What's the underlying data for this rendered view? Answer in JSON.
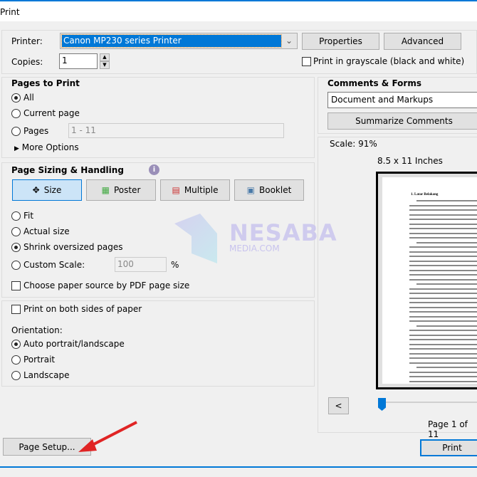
{
  "window": {
    "title": "Print"
  },
  "printer": {
    "label": "Printer:",
    "value": "Canon MP230 series Printer",
    "properties": "Properties",
    "advanced": "Advanced"
  },
  "copies": {
    "label": "Copies:",
    "value": "1"
  },
  "grayscale": {
    "label": "Print in grayscale (black and white)",
    "checked": false
  },
  "pages_to_print": {
    "title": "Pages to Print",
    "all": "All",
    "current": "Current page",
    "pages": "Pages",
    "pages_value": "1 - 11",
    "more": "More Options",
    "selected": "All"
  },
  "comments": {
    "title": "Comments & Forms",
    "value": "Document and Markups",
    "summarize": "Summarize Comments"
  },
  "sizing": {
    "title": "Page Sizing & Handling",
    "buttons": [
      "Size",
      "Poster",
      "Multiple",
      "Booklet"
    ],
    "active": "Size",
    "fit": "Fit",
    "actual": "Actual size",
    "shrink": "Shrink oversized pages",
    "custom": "Custom Scale:",
    "custom_value": "100",
    "percent": "%",
    "paper_source": "Choose paper source by PDF page size",
    "selected": "Shrink oversized pages"
  },
  "duplex": {
    "label": "Print on both sides of paper"
  },
  "orientation": {
    "title": "Orientation:",
    "auto": "Auto portrait/landscape",
    "portrait": "Portrait",
    "landscape": "Landscape",
    "selected": "Auto portrait/landscape"
  },
  "preview": {
    "scale": "Scale:  91%",
    "size": "8.5 x 11 Inches",
    "prev": "<",
    "page": "Page 1 of 11",
    "doc_heading": "1.  Latar Belakang",
    "current_page": 1,
    "total_pages": 11
  },
  "watermark": {
    "name": "NESABA",
    "sub": "MEDIA.COM"
  },
  "footer": {
    "page_setup": "Page Setup...",
    "print": "Print"
  },
  "colors": {
    "accent": "#0078d7",
    "arrow": "#e02424"
  }
}
